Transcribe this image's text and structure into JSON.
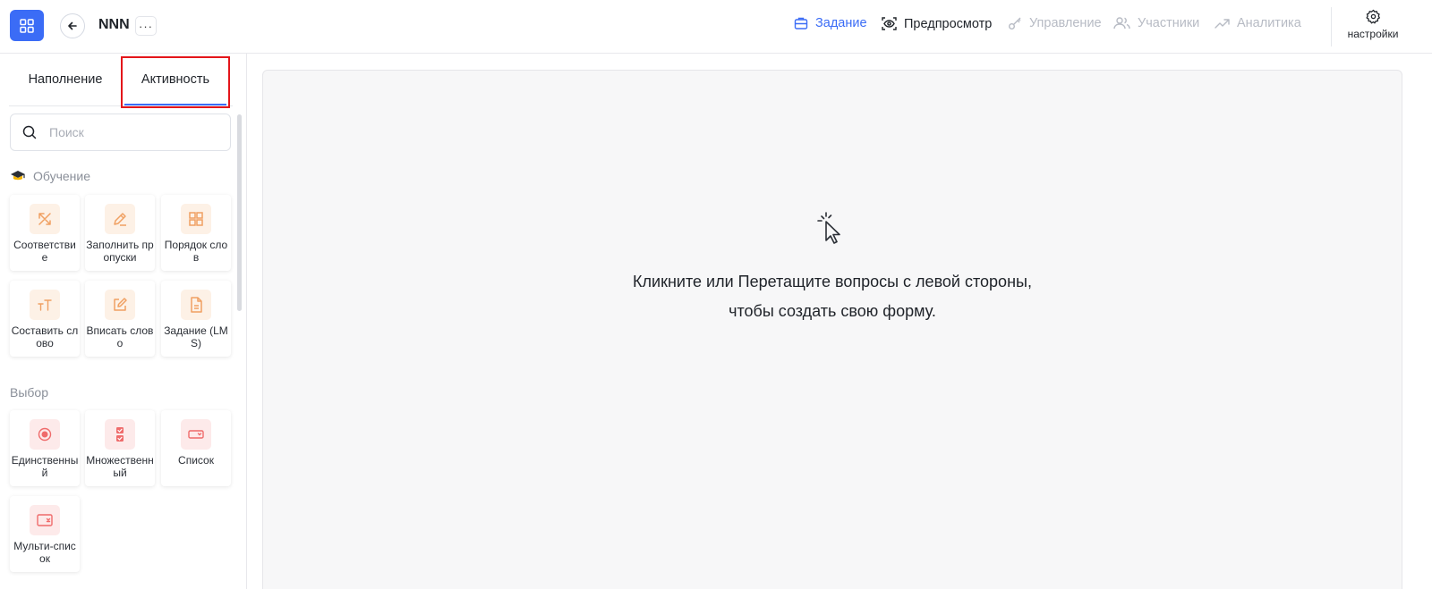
{
  "header": {
    "title": "NNN",
    "more_label": "···",
    "nav": {
      "task": "Задание",
      "preview": "Предпросмотр",
      "manage": "Управление",
      "members": "Участники",
      "analytics": "Аналитика"
    },
    "settings": "настройки"
  },
  "sidebar": {
    "tabs": {
      "content": "Наполнение",
      "activity": "Активность"
    },
    "search": {
      "placeholder": "Поиск"
    },
    "sections": {
      "learning": {
        "title": "Обучение",
        "items": [
          "Соответствие",
          "Заполнить пропуски",
          "Порядок слов",
          "Составить слово",
          "Вписать слово",
          "Задание (LMS)"
        ]
      },
      "choice": {
        "title": "Выбор",
        "items": [
          "Единственный",
          "Множественный",
          "Список",
          "Мульти-список"
        ]
      }
    }
  },
  "canvas": {
    "hint_line1": "Кликните или Перетащите вопросы с левой стороны,",
    "hint_line2": "чтобы создать свою форму."
  },
  "colors": {
    "accent": "#3b6cf6",
    "highlight": "#e4161b",
    "learning_icon": "#f0a062",
    "choice_icon": "#ef6b6b"
  }
}
